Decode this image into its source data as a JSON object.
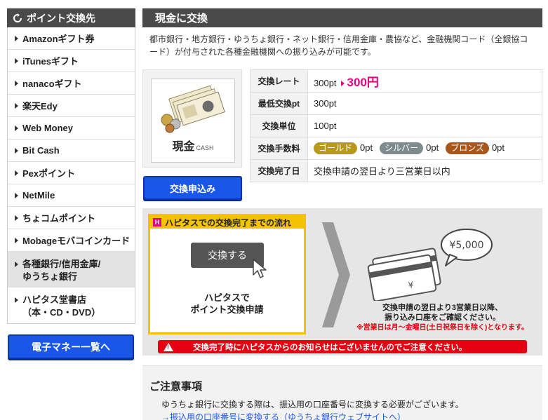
{
  "sidebar": {
    "title": "ポイント交換先",
    "items": [
      {
        "label": "Amazonギフト券"
      },
      {
        "label": "iTunesギフト"
      },
      {
        "label": "nanacoギフト"
      },
      {
        "label": "楽天Edy"
      },
      {
        "label": "Web Money"
      },
      {
        "label": "Bit Cash"
      },
      {
        "label": "Pexポイント"
      },
      {
        "label": "NetMile"
      },
      {
        "label": "ちょコムポイント"
      },
      {
        "label": "Mobageモバコインカード"
      },
      {
        "label_line1": "各種銀行/信用金庫/",
        "label_line2": "ゆうちょ銀行"
      },
      {
        "label_line1": "ハピタス堂書店",
        "label_line2": "（本・CD・DVD）"
      }
    ],
    "emoney_button": "電子マネー一覧へ"
  },
  "main": {
    "title": "現金に交換",
    "description": "都市銀行・地方銀行・ゆうちょ銀行・ネット銀行・信用金庫・農協など、金融機関コード（全銀協コード）が付与された各種金融機関への振り込みが可能です。",
    "thumb_label": "現金",
    "thumb_sub": "CASH",
    "apply_button": "交換申込み",
    "rows": {
      "rate_key": "交換レート",
      "rate_from": "300pt",
      "rate_to": "300円",
      "min_key": "最低交換pt",
      "min_val": "300pt",
      "unit_key": "交換単位",
      "unit_val": "100pt",
      "fee_key": "交換手数料",
      "fee_gold": "ゴールド",
      "fee_gold_val": "0pt",
      "fee_silver": "シルバー",
      "fee_silver_val": "0pt",
      "fee_bronze": "ブロンズ",
      "fee_bronze_val": "0pt",
      "done_key": "交換完了日",
      "done_val": "交換申請の翌日より三営業日以内"
    }
  },
  "flow": {
    "title": "ハピタスでの交換完了までの流れ",
    "logo": "H",
    "fake_button": "交換する",
    "step1_line1": "ハピタスで",
    "step1_line2": "ポイント交換申請",
    "amount": "¥5,000",
    "card_mark": "¥",
    "step2_line1": "交換申請の翌日より3営業日以降、",
    "step2_line2": "振り込み口座をご確認ください。",
    "step2_note": "※営業日は月～金曜日(土日祝祭日を除く)となります。",
    "notice": "交換完了時にハピタスからのお知らせはございませんのでご注意ください。"
  },
  "caution": {
    "title": "ご注意事項",
    "text": "ゆうちょ銀行に交換する際は、振込用の口座番号に変換する必要がございます。",
    "link": "→振込用の口座番号に変換する（ゆうちょ銀行ウェブサイトへ）"
  }
}
